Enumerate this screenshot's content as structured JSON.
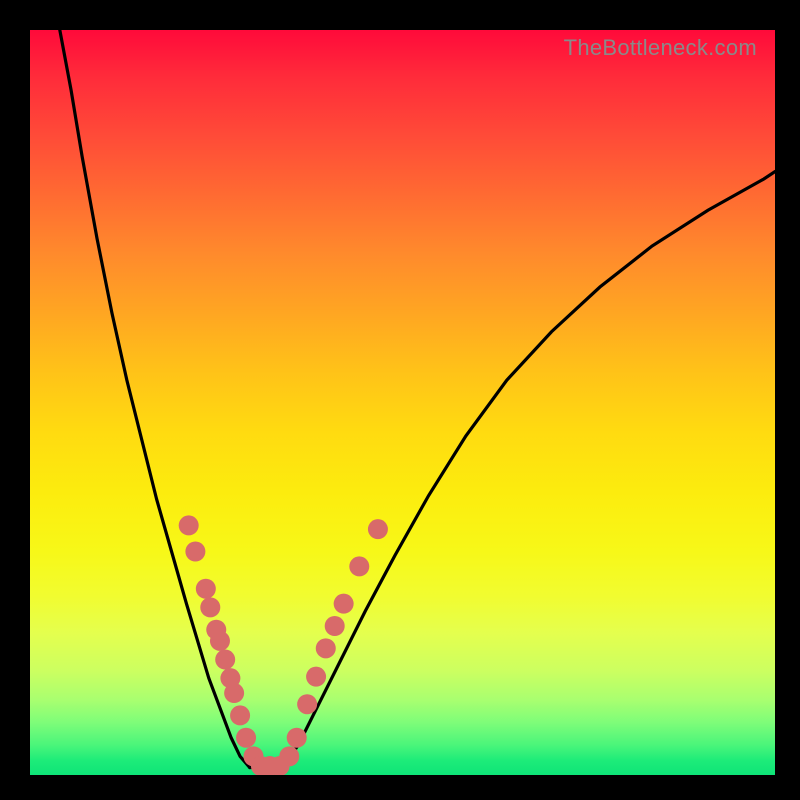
{
  "watermark": "TheBottleneck.com",
  "chart_data": {
    "type": "line",
    "title": "",
    "xlabel": "",
    "ylabel": "",
    "xlim": [
      0,
      100
    ],
    "ylim": [
      0,
      100
    ],
    "grid": false,
    "legend": false,
    "series": [
      {
        "name": "left-branch",
        "x": [
          4,
          5.5,
          7,
          9,
          11,
          13,
          15,
          17,
          19,
          21,
          22.5,
          24,
          25.5,
          27,
          28.2,
          29.5
        ],
        "y": [
          100,
          92,
          83,
          72,
          62,
          53,
          45,
          37,
          30,
          23,
          18,
          13,
          9,
          5,
          2.5,
          1
        ]
      },
      {
        "name": "floor",
        "x": [
          29.5,
          31,
          32.5,
          34
        ],
        "y": [
          1,
          1,
          1,
          1
        ]
      },
      {
        "name": "right-branch",
        "x": [
          34,
          36,
          38.5,
          41.5,
          45,
          49,
          53.5,
          58.5,
          64,
          70,
          76.5,
          83.5,
          91,
          98.5,
          100
        ],
        "y": [
          1.2,
          4,
          9,
          15,
          22,
          29.5,
          37.5,
          45.5,
          53,
          59.5,
          65.5,
          71,
          75.8,
          80,
          81
        ]
      }
    ],
    "markers": {
      "name": "data-points",
      "color": "#d86a6a",
      "radius_px": 10,
      "points": [
        {
          "x": 21.3,
          "y": 33.5
        },
        {
          "x": 22.2,
          "y": 30
        },
        {
          "x": 23.6,
          "y": 25
        },
        {
          "x": 24.2,
          "y": 22.5
        },
        {
          "x": 25.0,
          "y": 19.5
        },
        {
          "x": 25.5,
          "y": 18
        },
        {
          "x": 26.2,
          "y": 15.5
        },
        {
          "x": 26.9,
          "y": 13
        },
        {
          "x": 27.4,
          "y": 11
        },
        {
          "x": 28.2,
          "y": 8
        },
        {
          "x": 29.0,
          "y": 5
        },
        {
          "x": 30.0,
          "y": 2.5
        },
        {
          "x": 31.0,
          "y": 1.2
        },
        {
          "x": 32.2,
          "y": 1.2
        },
        {
          "x": 33.5,
          "y": 1.2
        },
        {
          "x": 34.8,
          "y": 2.5
        },
        {
          "x": 35.8,
          "y": 5
        },
        {
          "x": 37.2,
          "y": 9.5
        },
        {
          "x": 38.4,
          "y": 13.2
        },
        {
          "x": 39.7,
          "y": 17
        },
        {
          "x": 40.9,
          "y": 20
        },
        {
          "x": 42.1,
          "y": 23
        },
        {
          "x": 44.2,
          "y": 28
        },
        {
          "x": 46.7,
          "y": 33
        }
      ]
    }
  }
}
